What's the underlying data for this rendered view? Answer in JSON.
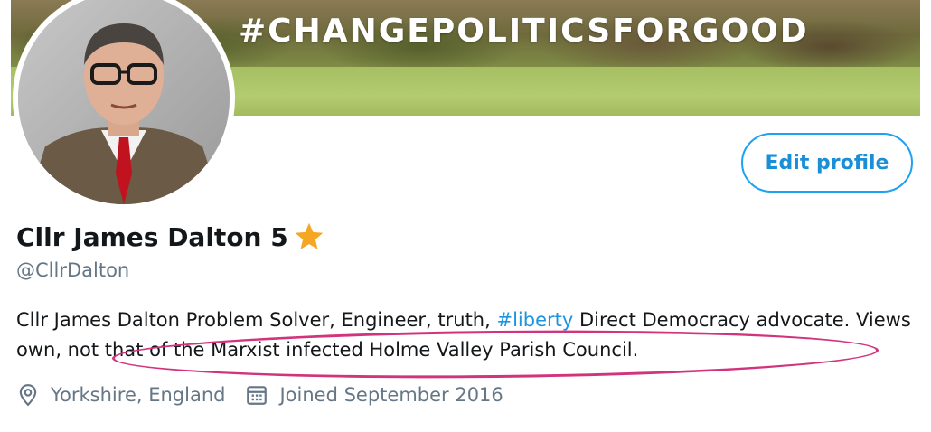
{
  "banner": {
    "text": "#CHANGEPOLITICSFORGOOD"
  },
  "profile": {
    "edit_label": "Edit profile",
    "name": "Cllr James Dalton 5",
    "handle": "@CllrDalton",
    "bio": {
      "part1": "Cllr James Dalton Problem Solver, Engineer, truth, ",
      "hashtag": "#liberty",
      "part2": " Direct Democracy advocate. ",
      "highlighted": "Views own, not that of the Marxist infected Holme Valley Parish Council."
    },
    "location": "Yorkshire, England",
    "joined": "Joined September 2016"
  },
  "icons": {
    "star": "star-icon",
    "location": "location-pin-icon",
    "calendar": "calendar-icon"
  },
  "colors": {
    "accent": "#1da1f2",
    "highlight_circle": "#d1337d",
    "star": "#f5a623",
    "secondary_text": "#657786"
  }
}
